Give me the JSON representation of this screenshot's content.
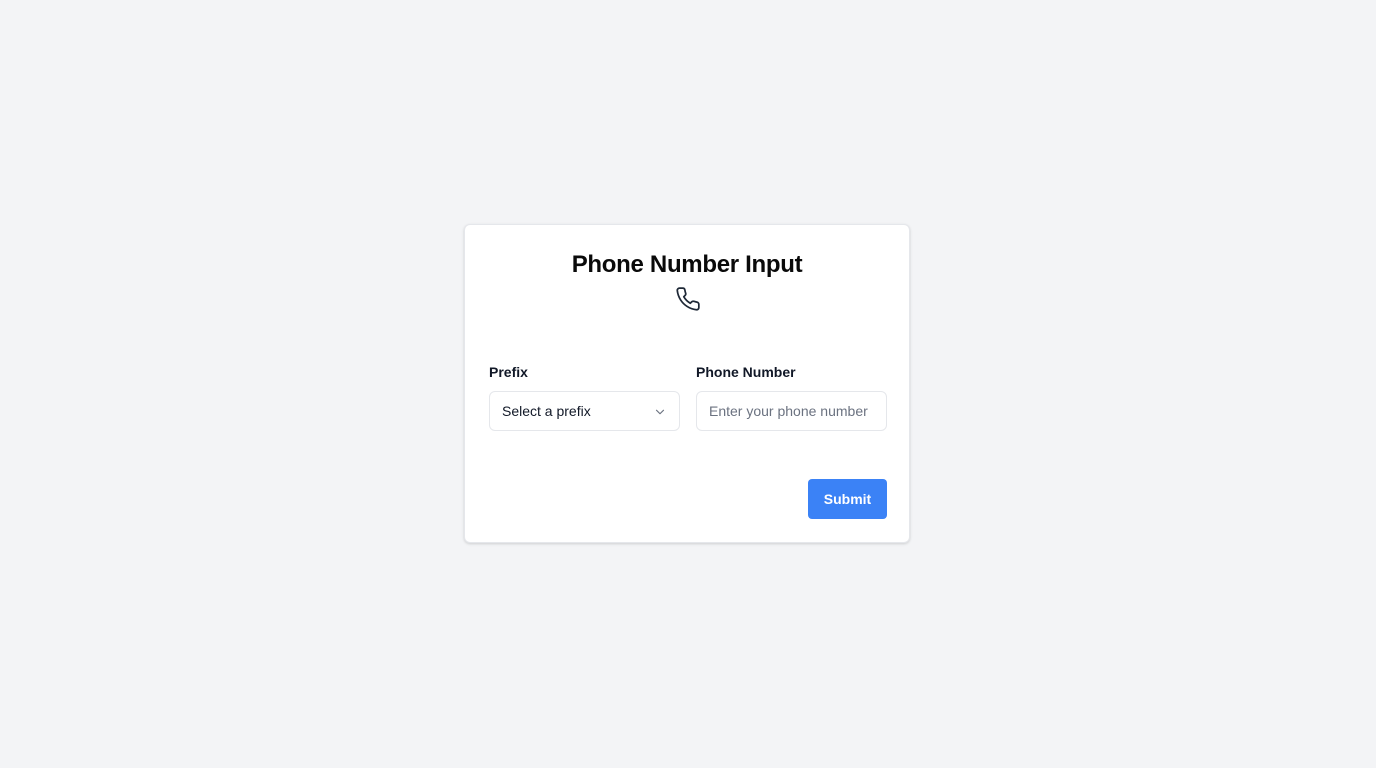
{
  "form": {
    "title": "Phone Number Input",
    "title_icon": "phone-icon",
    "prefix": {
      "label": "Prefix",
      "selected_value": "Select a prefix",
      "icon": "chevron-down-icon"
    },
    "phone_number": {
      "label": "Phone Number",
      "value": "",
      "placeholder": "Enter your phone number"
    },
    "submit_label": "Submit"
  },
  "colors": {
    "background": "#f3f4f6",
    "card": "#ffffff",
    "accent": "#3b82f6",
    "border": "#e5e7eb"
  }
}
